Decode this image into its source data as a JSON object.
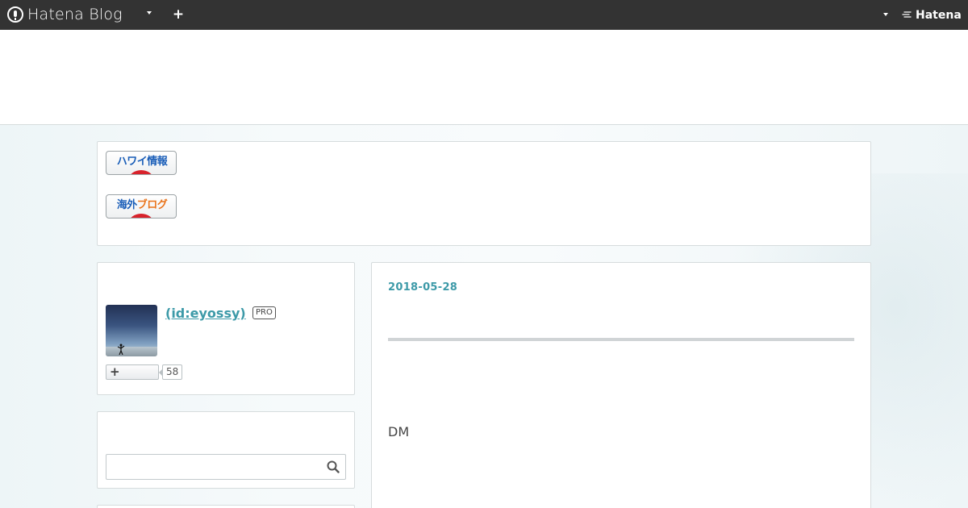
{
  "topbar": {
    "brand": "Hatena Blog",
    "hatena_label": "Hatena"
  },
  "banners": [
    {
      "text_a": "ハワイ情報",
      "text_b": ""
    },
    {
      "text_a": "海外",
      "text_b": "ブログ"
    }
  ],
  "profile": {
    "name": " (id:eyossy)",
    "badge": "PRO",
    "follow_count": "58"
  },
  "search": {
    "value": "",
    "placeholder": ""
  },
  "article": {
    "date": "2018-05-28",
    "body": "DM"
  },
  "colors": {
    "topbar_bg": "#333333",
    "accent_link": "#3d9aa8",
    "banner_blue": "#1a5eb8",
    "banner_orange": "#e9731a",
    "banner_red": "#d8222b"
  },
  "icons": {
    "brand": "hatena-blog-logo-icon",
    "menu": "caret-down-icon",
    "add": "plus-icon",
    "hatena": "hatena-logo-icon",
    "search": "search-icon",
    "follow": "plus-icon"
  }
}
